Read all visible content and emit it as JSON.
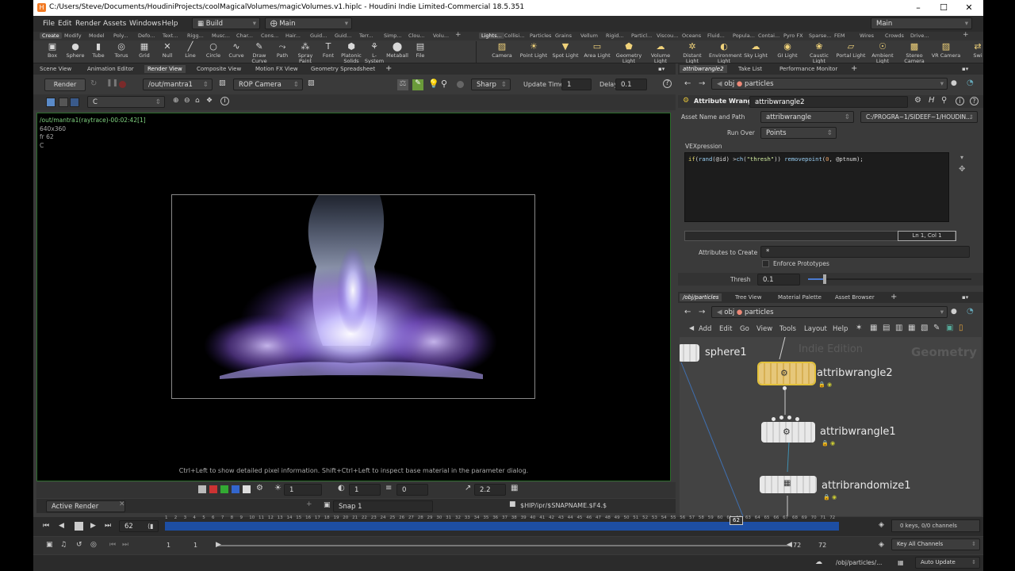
{
  "window": {
    "title": "C:/Users/Steve/Documents/HoudiniProjects/coolMagicalVolumes/magicVolumes.v1.hiplc - Houdini Indie Limited-Commercial 18.5.351",
    "icon_text": "H"
  },
  "menubar": {
    "items": [
      "File",
      "Edit",
      "Render",
      "Assets",
      "Windows",
      "Help"
    ],
    "desktop_build": "Build",
    "desktop_main": "Main",
    "right_main": "Main"
  },
  "shelf_tabs_left": [
    "Create",
    "Modify",
    "Model",
    "Poly...",
    "Defo...",
    "Text...",
    "Rigg...",
    "Musc...",
    "Char...",
    "Cons...",
    "Hair...",
    "Guid...",
    "Guid...",
    "Terr...",
    "Simp...",
    "Clou...",
    "Volu..."
  ],
  "shelf_tabs_right": [
    "Lights...",
    "Collisi...",
    "Particles",
    "Grains",
    "Vellum",
    "Rigid...",
    "Particl...",
    "Viscou...",
    "Oceans",
    "Fluid...",
    "Popula...",
    "Contai...",
    "Pyro FX",
    "Sparse...",
    "FEM",
    "Wires",
    "Crowds",
    "Drive..."
  ],
  "tools_left": [
    {
      "label": "Box",
      "icon": "box-icon"
    },
    {
      "label": "Sphere",
      "icon": "sphere-icon"
    },
    {
      "label": "Tube",
      "icon": "tube-icon"
    },
    {
      "label": "Torus",
      "icon": "torus-icon"
    },
    {
      "label": "Grid",
      "icon": "grid-icon"
    },
    {
      "label": "Null",
      "icon": "null-icon"
    },
    {
      "label": "Line",
      "icon": "line-icon"
    },
    {
      "label": "Circle",
      "icon": "circle-icon"
    },
    {
      "label": "Curve",
      "icon": "curve-icon"
    },
    {
      "label": "Draw Curve",
      "icon": "draw-curve-icon"
    },
    {
      "label": "Path",
      "icon": "path-icon"
    },
    {
      "label": "Spray Paint",
      "icon": "spray-paint-icon"
    },
    {
      "label": "Font",
      "icon": "font-icon"
    },
    {
      "label": "Platonic Solids",
      "icon": "platonic-icon"
    },
    {
      "label": "L-System",
      "icon": "lsystem-icon"
    },
    {
      "label": "Metaball",
      "icon": "metaball-icon"
    },
    {
      "label": "File",
      "icon": "file-icon"
    }
  ],
  "tools_right": [
    {
      "label": "Camera",
      "icon": "camera-icon"
    },
    {
      "label": "Point Light",
      "icon": "point-light-icon"
    },
    {
      "label": "Spot Light",
      "icon": "spot-light-icon"
    },
    {
      "label": "Area Light",
      "icon": "area-light-icon"
    },
    {
      "label": "Geometry Light",
      "icon": "geometry-light-icon"
    },
    {
      "label": "Volume Light",
      "icon": "volume-light-icon"
    },
    {
      "label": "Distant Light",
      "icon": "distant-light-icon"
    },
    {
      "label": "Environment Light",
      "icon": "environment-light-icon"
    },
    {
      "label": "Sky Light",
      "icon": "sky-light-icon"
    },
    {
      "label": "GI Light",
      "icon": "gi-light-icon"
    },
    {
      "label": "Caustic Light",
      "icon": "caustic-light-icon"
    },
    {
      "label": "Portal Light",
      "icon": "portal-light-icon"
    },
    {
      "label": "Ambient Light",
      "icon": "ambient-light-icon"
    },
    {
      "label": "Stereo Camera",
      "icon": "stereo-camera-icon"
    },
    {
      "label": "VR Camera",
      "icon": "vr-camera-icon"
    },
    {
      "label": "Swi",
      "icon": "switcher-icon"
    }
  ],
  "left_pane_tabs": [
    "Scene View",
    "Animation Editor",
    "Render View",
    "Composite View",
    "Motion FX View",
    "Geometry Spreadsheet"
  ],
  "render_view": {
    "render_button": "Render",
    "output_path": "/out/mantra1",
    "camera": "ROP Camera",
    "sharp": "Sharp",
    "update_time_label": "Update Time",
    "update_time_value": "1",
    "delay_label": "Delay",
    "delay_value": "0.1",
    "channel": "C",
    "info_line1": "/out/mantra1(raytrace)-00:02:42[1]",
    "info_resolution": "640x360",
    "info_frame": "fr 62",
    "info_channel": "C",
    "hint": "Ctrl+Left to show detailed pixel information. Shift+Ctrl+Left to inspect base material in the parameter dialog.",
    "bottom_value_1": "1",
    "bottom_value_2": "1",
    "bottom_value_3": "0",
    "bottom_value_4": "2.2",
    "active_render": "Active Render",
    "snap": "Snap 1",
    "snap_path": "$HIP/ipr/$SNAPNAME.$F4.$"
  },
  "params": {
    "tab_name": "attribwrangle2",
    "tabs": [
      "Take List",
      "Performance Monitor"
    ],
    "path_obj": "obj",
    "path_node": "particles",
    "node_type": "Attribute Wrangle",
    "node_name": "attribwrangle2",
    "asset_label": "Asset Name and Path",
    "asset_value": "attribwrangle",
    "asset_path": "C:/PROGRA~1/SIDEEF~1/HOUDIN...",
    "run_over_label": "Run Over",
    "run_over_value": "Points",
    "vex_label": "VEXpression",
    "vex_code": {
      "kw1": "if",
      "p1": "(",
      "fn1": "rand",
      "p2": "(@id) >",
      "fn2": "ch",
      "p3": "(",
      "str": "\"thresh\"",
      "p4": ")) ",
      "fn3": "removepoint",
      "p5": "(",
      "num": "0",
      "p6": ", @ptnum);"
    },
    "cursor_pos": "Ln 1, Col 1",
    "attrs_label": "Attributes to Create",
    "attrs_value": "*",
    "enforce_label": "Enforce Prototypes",
    "thresh_label": "Thresh",
    "thresh_value": "0.1",
    "thresh_fraction": 0.1
  },
  "network": {
    "tabs": [
      "/obj/particles",
      "Tree View",
      "Material Palette",
      "Asset Browser"
    ],
    "path_obj": "obj",
    "path_node": "particles",
    "menu": [
      "Add",
      "Edit",
      "Go",
      "View",
      "Tools",
      "Layout",
      "Help"
    ],
    "watermark_edition": "Indie Edition",
    "watermark_context": "Geometry",
    "nodes": {
      "sphere": "sphere1",
      "wrangle2": "attribwrangle2",
      "wrangle1": "attribwrangle1",
      "randomize": "attribrandomize1"
    }
  },
  "timeline": {
    "current_frame": "62",
    "cursor_label": "62",
    "ticks": [
      "1",
      "2",
      "3",
      "4",
      "5",
      "6",
      "7",
      "8",
      "9",
      "10",
      "11",
      "12",
      "13",
      "14",
      "15",
      "16",
      "17",
      "18",
      "19",
      "20",
      "21",
      "22",
      "23",
      "24",
      "25",
      "26",
      "27",
      "28",
      "29",
      "30",
      "31",
      "32",
      "33",
      "34",
      "35",
      "36",
      "37",
      "38",
      "39",
      "40",
      "41",
      "42",
      "43",
      "44",
      "45",
      "46",
      "47",
      "48",
      "49",
      "50",
      "51",
      "52",
      "53",
      "54",
      "55",
      "56",
      "57",
      "58",
      "59",
      "60",
      "61",
      "62",
      "63",
      "64",
      "65",
      "66",
      "67",
      "68",
      "69",
      "70",
      "71",
      "72"
    ],
    "keys_info": "0 keys, 0/0 channels",
    "key_all": "Key All Channels",
    "range_start_1": "1",
    "range_start_2": "1",
    "range_end_1": "72",
    "range_end_2": "72",
    "status_path": "/obj/particles/...",
    "auto_update": "Auto Update"
  }
}
